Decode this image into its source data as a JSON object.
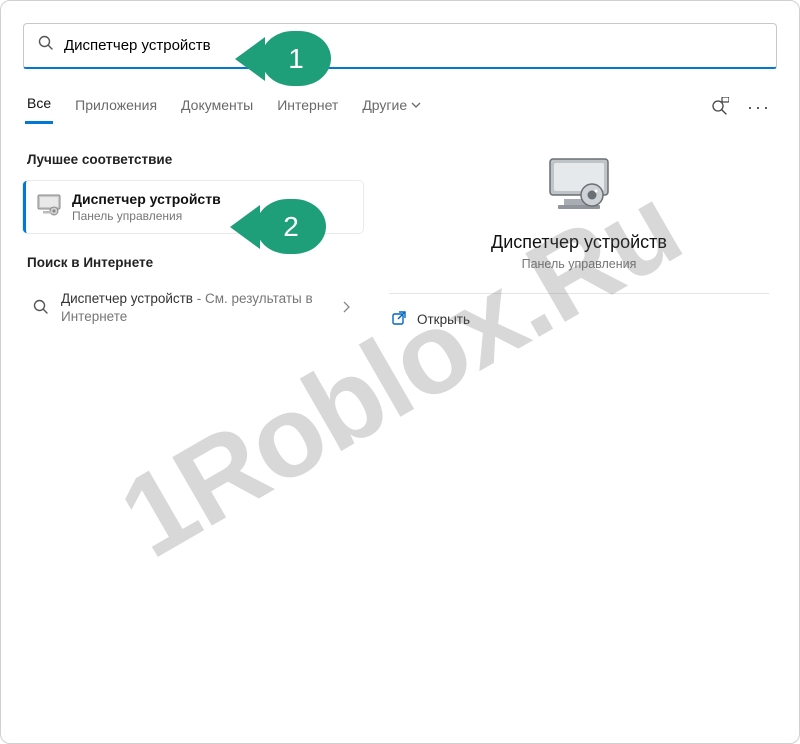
{
  "search": {
    "value": "Диспетчер устройств"
  },
  "tabs": {
    "items": [
      {
        "label": "Все",
        "active": true
      },
      {
        "label": "Приложения",
        "active": false
      },
      {
        "label": "Документы",
        "active": false
      },
      {
        "label": "Интернет",
        "active": false
      },
      {
        "label": "Другие",
        "active": false
      }
    ]
  },
  "left": {
    "best_match_heading": "Лучшее соответствие",
    "best_match": {
      "title": "Диспетчер устройств",
      "subtitle": "Панель управления"
    },
    "web_heading": "Поиск в Интернете",
    "web_item": {
      "prefix": "Диспетчер устройств",
      "suffix": " - См. результаты в Интернете"
    }
  },
  "detail": {
    "title": "Диспетчер устройств",
    "subtitle": "Панель управления",
    "open_label": "Открыть"
  },
  "badges": {
    "one": "1",
    "two": "2"
  },
  "watermark": "1Roblox.Ru"
}
